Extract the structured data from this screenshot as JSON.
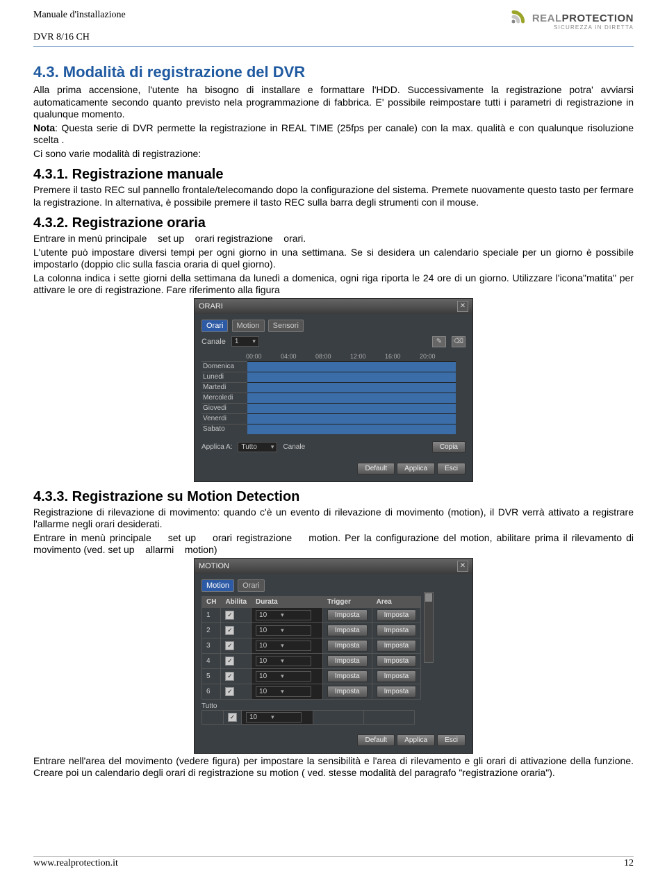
{
  "header": {
    "doc_title": "Manuale d'installazione",
    "model": "DVR 8/16 CH",
    "brand_light": "REAL",
    "brand_bold": "PROTECTION",
    "brand_tag": "SICUREZZA IN DIRETTA"
  },
  "h43": "4.3. Modalità di registrazione del DVR",
  "p43a": "Alla prima accensione, l'utente ha bisogno di installare e formattare l'HDD. Successivamente la registrazione potra' avviarsi automaticamente secondo quanto previsto nela programmazione di fabbrica. E' possibile reimpostare tutti i parametri di registrazione in qualunque momento.",
  "nota_label": "Nota",
  "p43b": ": Questa serie di DVR permette la registrazione in REAL TIME (25fps per canale) con la max. qualità e con qualunque risoluzione scelta .",
  "p43c": "Ci sono varie modalità di registrazione:",
  "h431": "4.3.1. Registrazione manuale",
  "p431": "Premere il tasto REC sul pannello frontale/telecomando dopo la configurazione del sistema. Premete nuovamente questo tasto per fermare la registrazione. In alternativa, è possibile premere il tasto REC sulla barra degli strumenti con il mouse.",
  "h432": "4.3.2. Registrazione oraria",
  "p432a": "Entrare in menù principale    set up    orari registrazione    orari.",
  "p432b": "L'utente può impostare diversi tempi per ogni giorno in una settimana. Se si desidera un calendario speciale per un giorno è possibile impostarlo (doppio clic sulla fascia oraria di quel giorno).",
  "p432c": "La colonna indica i sette giorni della settimana da lunedì a domenica, ogni riga riporta le 24 ore di un giorno. Utilizzare l'icona\"matita\" per attivare le ore di registrazione. Fare riferimento alla figura",
  "orari": {
    "title": "ORARI",
    "tabs": [
      "Orari",
      "Motion",
      "Sensori"
    ],
    "canale_label": "Canale",
    "canale_value": "1",
    "hours": [
      "00:00",
      "04:00",
      "08:00",
      "12:00",
      "16:00",
      "20:00"
    ],
    "days": [
      "Domenica",
      "Lunedi",
      "Martedi",
      "Mercoledi",
      "Giovedi",
      "Venerdi",
      "Sabato"
    ],
    "applica_a": "Applica A:",
    "tutto": "Tutto",
    "canale": "Canale",
    "copia": "Copia",
    "default": "Default",
    "applica": "Applica",
    "esci": "Esci",
    "pencil": "✎",
    "eraser": "⌫"
  },
  "h433": "4.3.3. Registrazione su Motion Detection",
  "p433a": "Registrazione di rilevazione di movimento: quando c'è un evento di rilevazione di movimento (motion), il DVR verrà attivato a registrare l'allarme negli orari desiderati.",
  "p433b": "Entrare in menù principale    set up    orari registrazione    motion. Per la configurazione del motion, abilitare prima il rilevamento di movimento (ved. set up    allarmi    motion)",
  "motion": {
    "title": "MOTION",
    "tabs": [
      "Motion",
      "Orari"
    ],
    "cols": [
      "CH",
      "Abilita",
      "Durata",
      "Trigger",
      "Area"
    ],
    "rows": [
      {
        "ch": "1",
        "enabled": true,
        "durata": "10",
        "trigger": "Imposta",
        "area": "Imposta"
      },
      {
        "ch": "2",
        "enabled": true,
        "durata": "10",
        "trigger": "Imposta",
        "area": "Imposta"
      },
      {
        "ch": "3",
        "enabled": true,
        "durata": "10",
        "trigger": "Imposta",
        "area": "Imposta"
      },
      {
        "ch": "4",
        "enabled": true,
        "durata": "10",
        "trigger": "Imposta",
        "area": "Imposta"
      },
      {
        "ch": "5",
        "enabled": true,
        "durata": "10",
        "trigger": "Imposta",
        "area": "Imposta"
      },
      {
        "ch": "6",
        "enabled": true,
        "durata": "10",
        "trigger": "Imposta",
        "area": "Imposta"
      }
    ],
    "tutto": "Tutto",
    "all_enabled": true,
    "all_durata": "10",
    "default": "Default",
    "applica": "Applica",
    "esci": "Esci"
  },
  "p433c": "Entrare nell'area del movimento (vedere figura) per impostare la sensibilità e l'area di rilevamento e gli orari di attivazione della funzione. Creare poi un calendario degli orari di registrazione su motion ( ved. stesse modalità del paragrafo \"registrazione oraria\").",
  "footer": {
    "site": "www.realprotection.it",
    "page": "12"
  }
}
